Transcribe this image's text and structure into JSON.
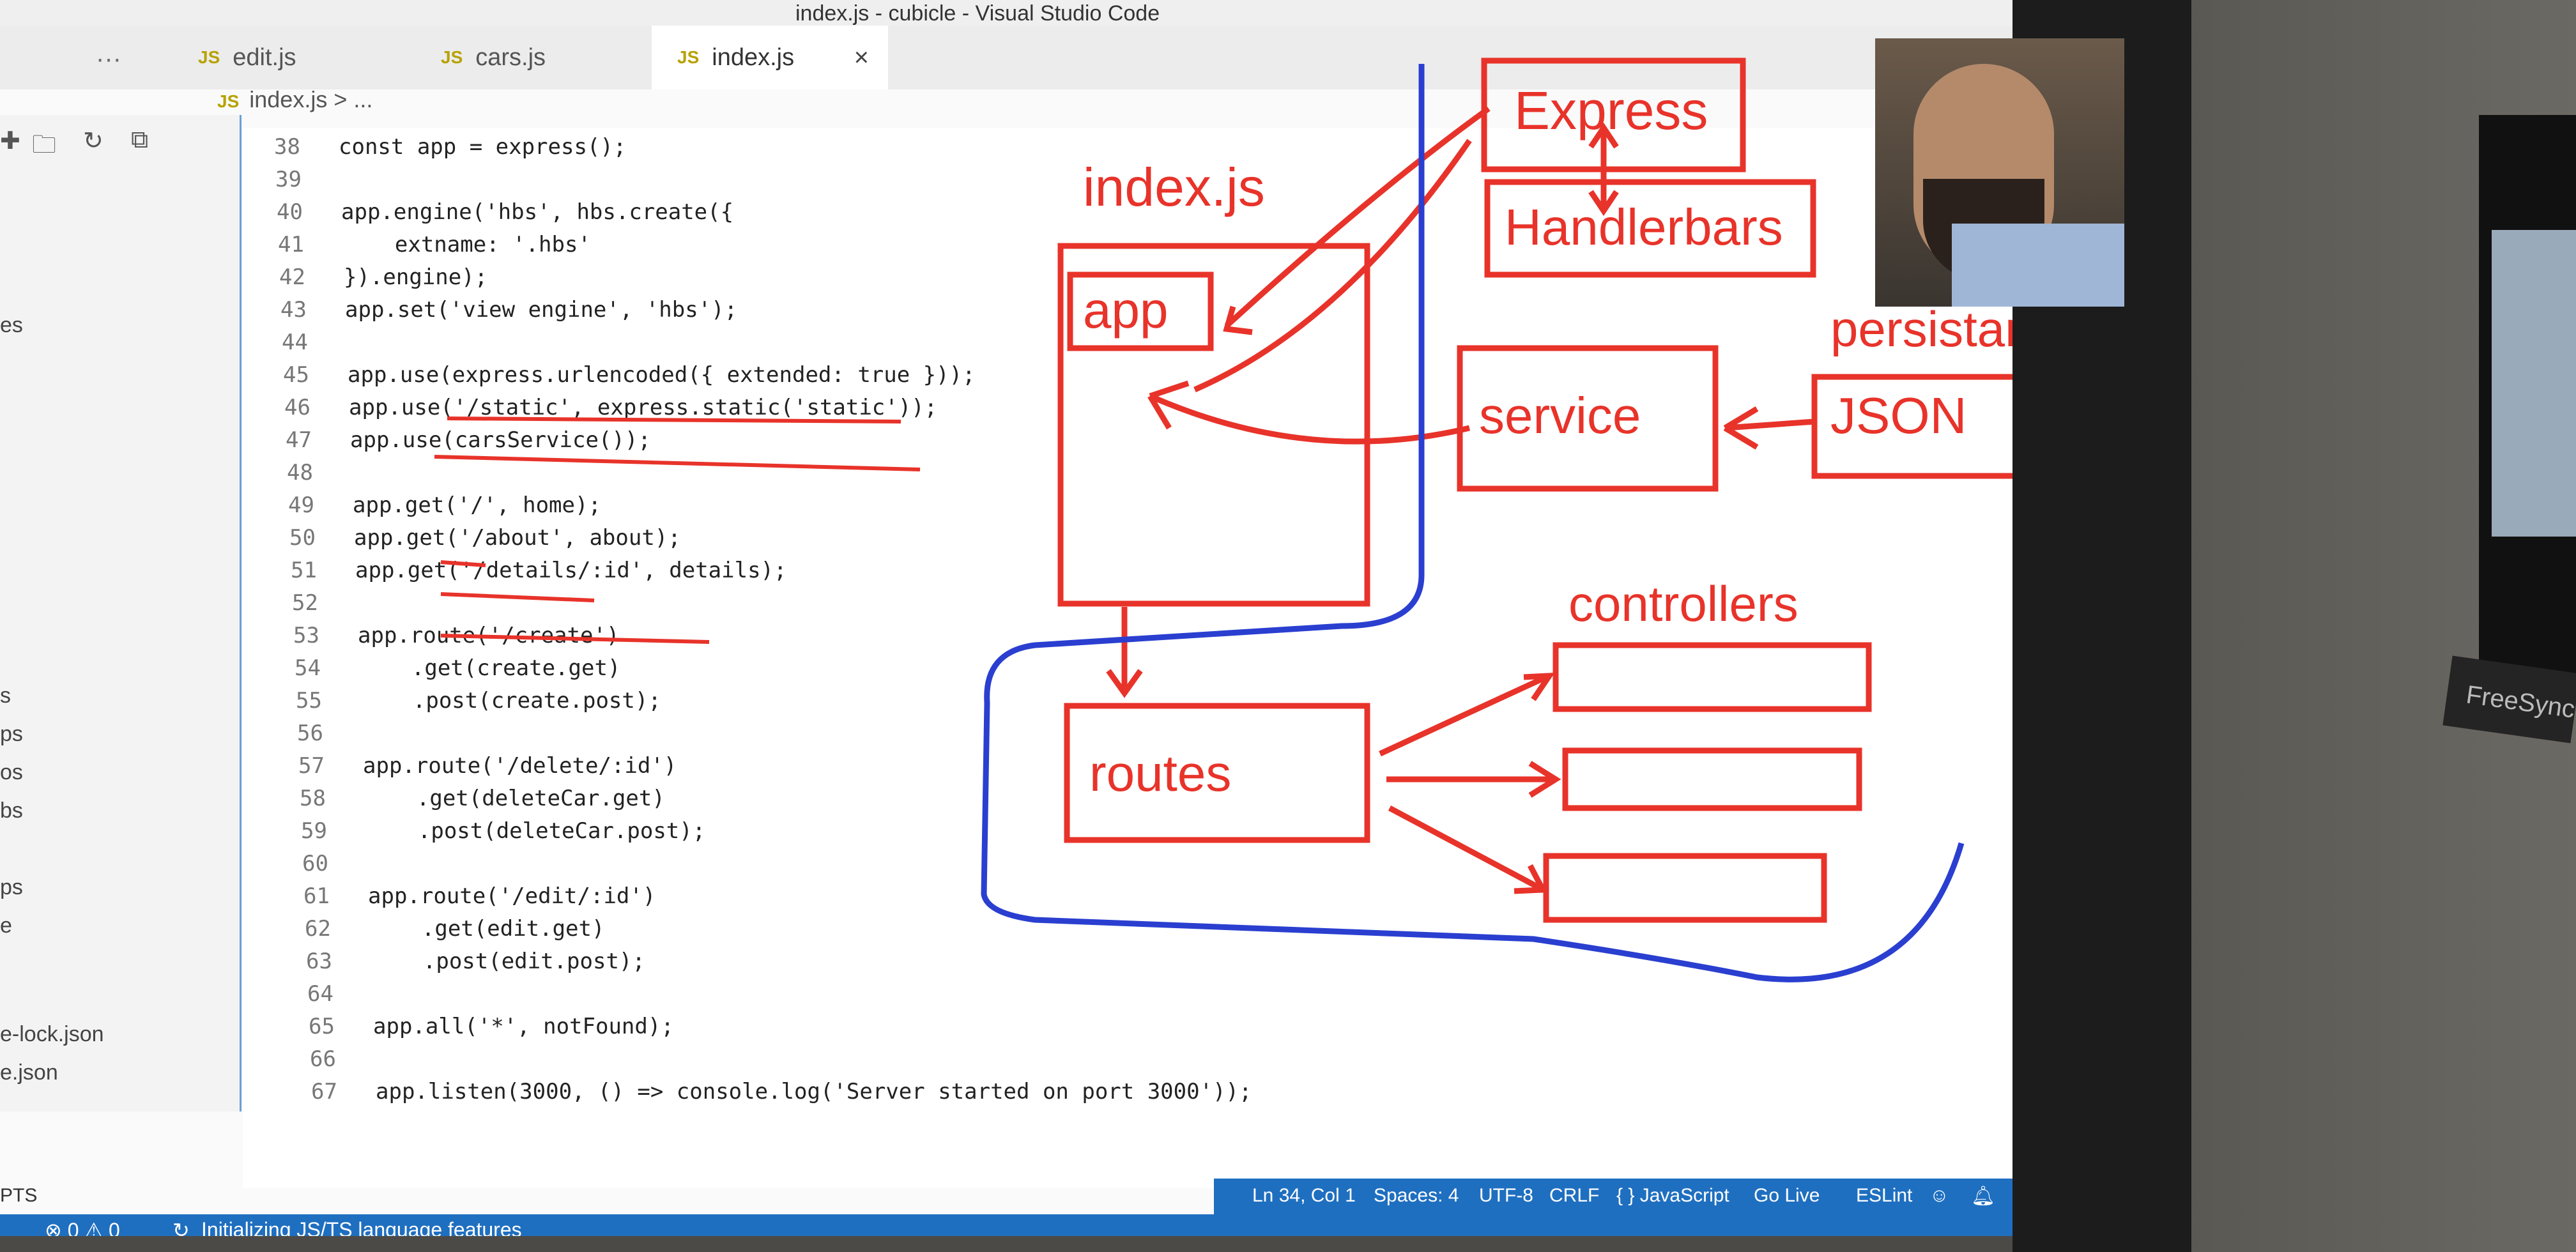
{
  "window": {
    "title": "index.js - cubicle - Visual Studio Code"
  },
  "tabs": [
    {
      "label": "edit.js",
      "prefix": "JS"
    },
    {
      "label": "cars.js",
      "prefix": "JS"
    },
    {
      "label": "index.js",
      "prefix": "JS",
      "close": "×"
    }
  ],
  "tab_more": "···",
  "breadcrumb": {
    "prefix": "JS",
    "text": "index.js > ..."
  },
  "sidebar": {
    "items": [
      "es",
      "s",
      "ps",
      "os",
      "bs",
      "ps",
      "e",
      "e-lock.json",
      "e.json"
    ],
    "section": "PTS"
  },
  "code": [
    {
      "n": "38",
      "t": "const app = express();"
    },
    {
      "n": "39",
      "t": ""
    },
    {
      "n": "40",
      "t": "app.engine('hbs', hbs.create({"
    },
    {
      "n": "41",
      "t": "    extname: '.hbs'"
    },
    {
      "n": "42",
      "t": "}).engine);"
    },
    {
      "n": "43",
      "t": "app.set('view engine', 'hbs');"
    },
    {
      "n": "44",
      "t": ""
    },
    {
      "n": "45",
      "t": "app.use(express.urlencoded({ extended: true }));"
    },
    {
      "n": "46",
      "t": "app.use('/static', express.static('static'));"
    },
    {
      "n": "47",
      "t": "app.use(carsService());"
    },
    {
      "n": "48",
      "t": ""
    },
    {
      "n": "49",
      "t": "app.get('/', home);"
    },
    {
      "n": "50",
      "t": "app.get('/about', about);"
    },
    {
      "n": "51",
      "t": "app.get('/details/:id', details);"
    },
    {
      "n": "52",
      "t": ""
    },
    {
      "n": "53",
      "t": "app.route('/create')"
    },
    {
      "n": "54",
      "t": "    .get(create.get)"
    },
    {
      "n": "55",
      "t": "    .post(create.post);"
    },
    {
      "n": "56",
      "t": ""
    },
    {
      "n": "57",
      "t": "app.route('/delete/:id')"
    },
    {
      "n": "58",
      "t": "    .get(deleteCar.get)"
    },
    {
      "n": "59",
      "t": "    .post(deleteCar.post);"
    },
    {
      "n": "60",
      "t": ""
    },
    {
      "n": "61",
      "t": "app.route('/edit/:id')"
    },
    {
      "n": "62",
      "t": "    .get(edit.get)"
    },
    {
      "n": "63",
      "t": "    .post(edit.post);"
    },
    {
      "n": "64",
      "t": ""
    },
    {
      "n": "65",
      "t": "app.all('*', notFound);"
    },
    {
      "n": "66",
      "t": ""
    },
    {
      "n": "67",
      "t": "app.listen(3000, () => console.log('Server started on port 3000'));"
    }
  ],
  "diagram": {
    "title": "index.js",
    "labels": {
      "express": "Express",
      "handlebars": "Handlerbars",
      "app": "app",
      "persistence": "persistance",
      "service": "service",
      "json": "JSON",
      "controllers": "controllers",
      "routes": "routes"
    },
    "colors": {
      "red": "#e8332a",
      "blue": "#2a3fd0"
    }
  },
  "statusbar": {
    "position": "Ln 34, Col 1",
    "spaces": "Spaces: 4",
    "encoding": "UTF-8",
    "eol": "CRLF",
    "language": "{ } JavaScript",
    "golive": "Go Live",
    "eslint": "ESLint",
    "problems": "⊗ 0 ⚠ 0",
    "message": "Initializing JS/TS language features"
  },
  "freesync": "FreeSync"
}
